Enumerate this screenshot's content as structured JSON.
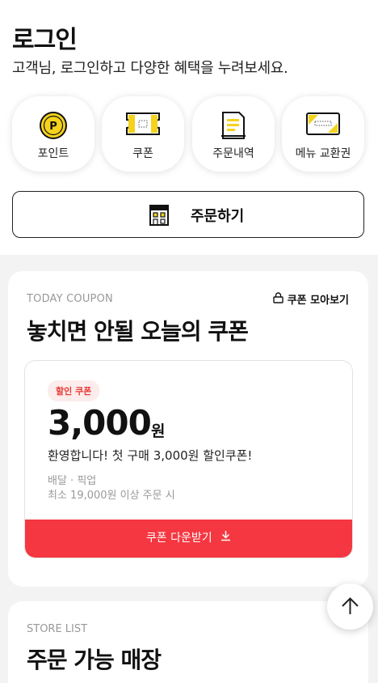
{
  "header": {
    "title": "로그인",
    "subtitle": "고객님, 로그인하고 다양한 혜택을 누려보세요."
  },
  "quick_menu": [
    {
      "label": "포인트",
      "icon": "point-coin-icon"
    },
    {
      "label": "쿠폰",
      "icon": "coupon-ticket-icon"
    },
    {
      "label": "주문내역",
      "icon": "receipt-icon"
    },
    {
      "label": "메뉴 교환권",
      "icon": "voucher-card-icon"
    }
  ],
  "order_button": {
    "label": "주문하기",
    "icon": "store-icon"
  },
  "coupon_section": {
    "eyebrow": "TODAY COUPON",
    "view_all": "쿠폰 모아보기",
    "title": "놓치면 안될 오늘의 쿠폰",
    "coupon": {
      "badge": "할인 쿠폰",
      "amount": "3,000",
      "unit": "원",
      "description": "환영합니다! 첫 구매 3,000원 할인쿠폰!",
      "meta_type": "배달 · 픽업",
      "meta_min": "최소 19,000원 이상 주문 시",
      "download_label": "쿠폰 다운받기"
    }
  },
  "store_section": {
    "eyebrow": "STORE LIST",
    "title": "주문 가능 매장"
  },
  "colors": {
    "accent_red": "#f53741",
    "icon_yellow": "#f5d21c",
    "badge_bg": "#fdecec"
  }
}
